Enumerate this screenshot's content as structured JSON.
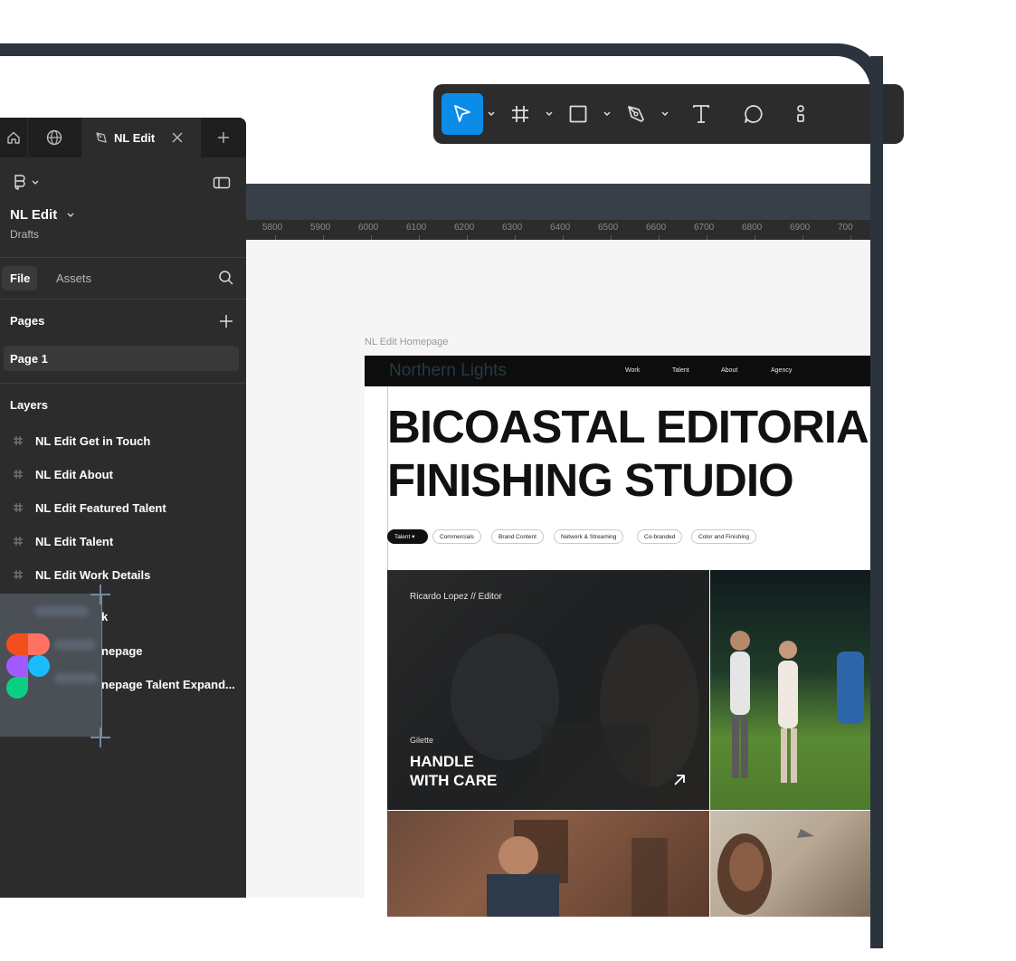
{
  "toolbar": {
    "tools": [
      "move-tool",
      "frame-tool",
      "shape-tool",
      "pen-tool",
      "text-tool",
      "comment-tool",
      "actions-tool"
    ]
  },
  "tabs": {
    "active_label": "NL Edit"
  },
  "file": {
    "name": "NL Edit",
    "location": "Drafts"
  },
  "panel_tabs": {
    "file": "File",
    "assets": "Assets"
  },
  "pages": {
    "heading": "Pages",
    "items": [
      "Page 1"
    ]
  },
  "layers": {
    "heading": "Layers",
    "items": [
      "NL Edit Get in Touch",
      "NL Edit About",
      "NL Edit Featured Talent",
      "NL Edit Talent",
      "NL Edit Work Details",
      "k",
      "nepage",
      "nepage Talent Expand..."
    ]
  },
  "ruler": {
    "ticks": [
      "5800",
      "5900",
      "6000",
      "6100",
      "6200",
      "6300",
      "6400",
      "6500",
      "6600",
      "6700",
      "6800",
      "6900",
      "700"
    ]
  },
  "site": {
    "frame_label": "NL Edit Homepage",
    "logo": "Northern Lights",
    "nav": [
      "Work",
      "Talent",
      "About",
      "Agency"
    ],
    "headline_1": "BICOASTAL EDITORIA",
    "headline_2": "FINISHING STUDIO",
    "filters": [
      "Talent",
      "Commercials",
      "Brand Content",
      "Network & Streaming",
      "Co-branded",
      "Color and Finishing"
    ],
    "card": {
      "credit": "Ricardo Lopez // Editor",
      "client": "Gilette",
      "title_1": "HANDLE",
      "title_2": "WITH CARE"
    }
  },
  "colors": {
    "panel": "#2c2c2c",
    "accent": "#0c8ce9",
    "frame": "#2b333c"
  }
}
